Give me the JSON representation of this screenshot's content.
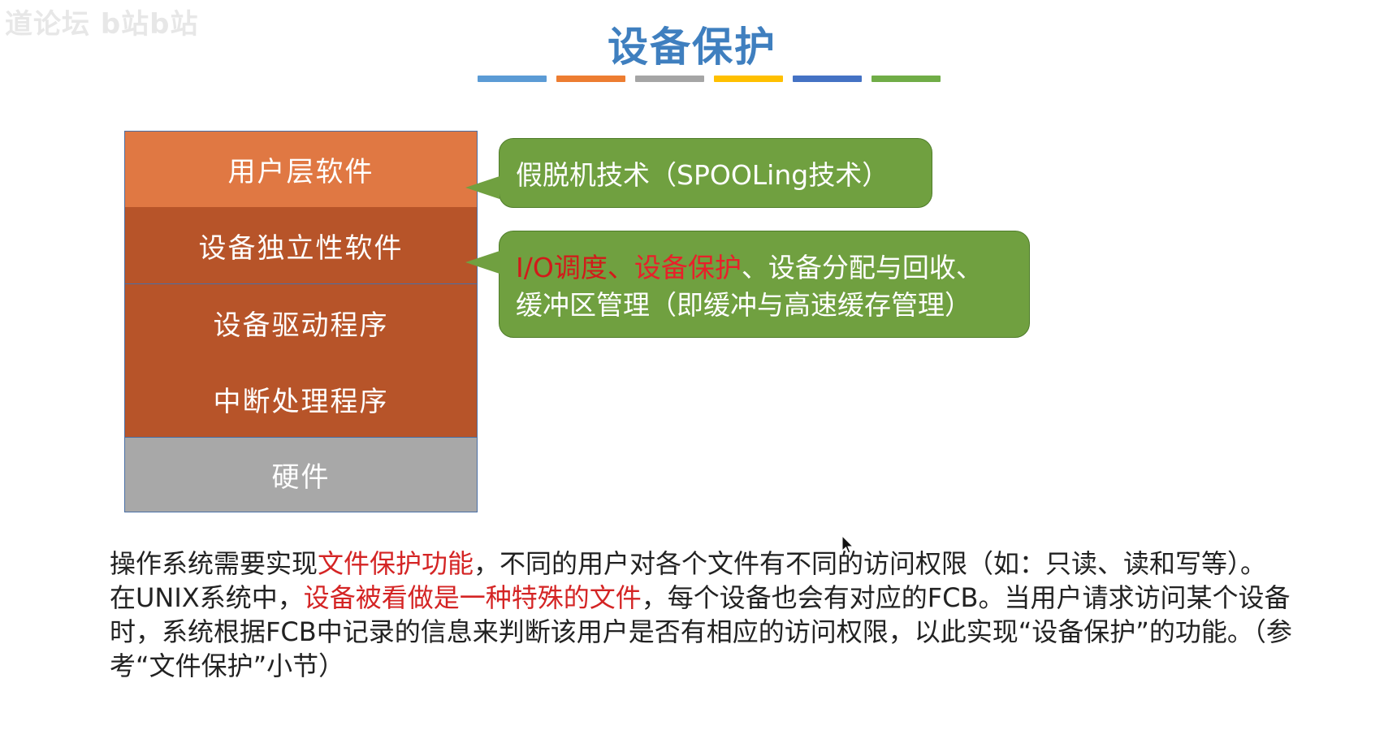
{
  "watermark": "道论坛  b站b站",
  "slide": {
    "title": "设备保护",
    "title_bar_colors": [
      "#5b9bd5",
      "#ed7d31",
      "#a5a5a5",
      "#ffc000",
      "#4472c4",
      "#70ad47"
    ]
  },
  "stack": {
    "layers": [
      {
        "label": "用户层软件"
      },
      {
        "label": "设备独立性软件"
      },
      {
        "label": "设备驱动程序"
      },
      {
        "label": "中断处理程序"
      },
      {
        "label": "硬件"
      }
    ]
  },
  "callouts": {
    "spooling": "假脱机技术（SPOOLing技术）",
    "indep": {
      "io_sched": "I/O调度",
      "sep1": "、",
      "protect": "设备保护",
      "rest1": "、设备分配与回收、",
      "line2": "缓冲区管理（即缓冲与高速缓存管理）"
    }
  },
  "paragraphs": {
    "p1": {
      "a": "操作系统需要实现",
      "hi": "文件保护功能",
      "b": "，不同的用户对各个文件有不同的访问权限（如：只读、读和写等）。"
    },
    "p2": {
      "a": "在UNIX系统中，",
      "hi": "设备被看做是一种特殊的文件",
      "b": "，每个设备也会有对应的FCB。当用户请求访问某个设备时，系统根据FCB中记录的信息来判断该用户是否有相应的访问权限，以此实现“设备保护”的功能。（参考“文件保护”小节）"
    }
  },
  "colors": {
    "title": "#3f7fbf",
    "user_layer": "#e07843",
    "mid_layers": "#b75429",
    "hardware": "#a8a8a8",
    "callout": "#70a040",
    "highlight": "#d21a1a"
  }
}
